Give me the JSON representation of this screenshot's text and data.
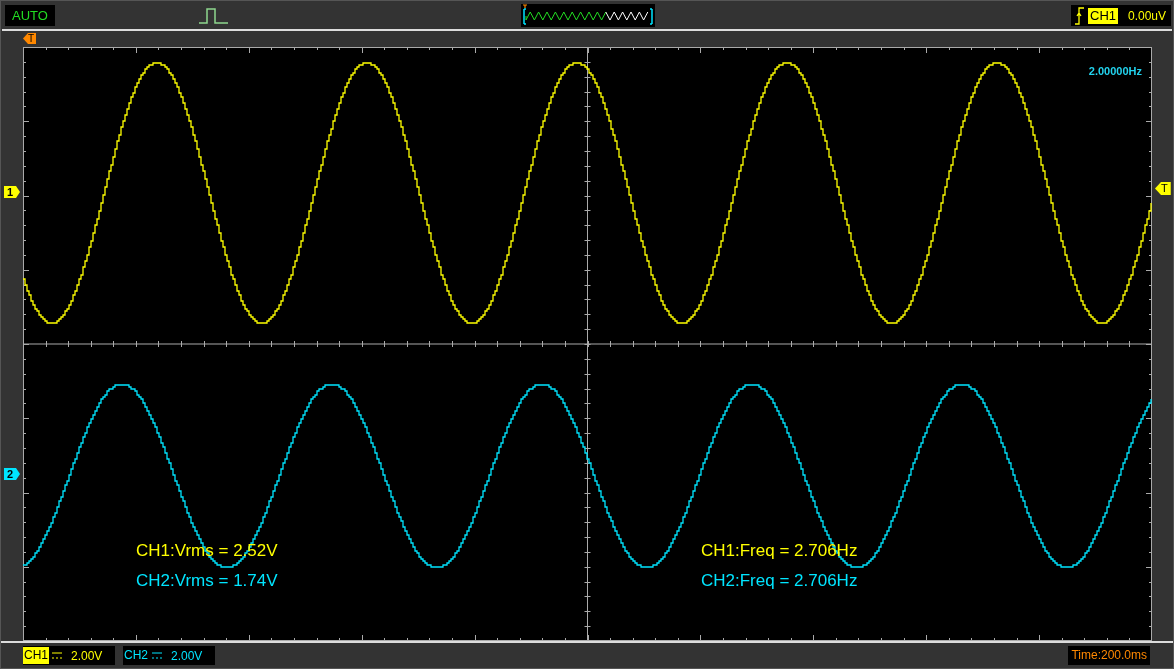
{
  "top_bar": {
    "mode": "AUTO",
    "trigger": {
      "channel": "CH1",
      "level": "0.00uV"
    }
  },
  "trigger_position_marker": "T",
  "trigger_level_marker": "T",
  "channel_markers": [
    {
      "label": "1",
      "color": "#ffff00"
    },
    {
      "label": "2",
      "color": "#00e5ff"
    }
  ],
  "frequency_readout": "2.00000Hz",
  "measurements": [
    {
      "text": "CH1:Vrms = 2.52V",
      "color": "#ffff00"
    },
    {
      "text": "CH1:Freq = 2.706Hz",
      "color": "#ffff00"
    },
    {
      "text": "CH2:Vrms = 1.74V",
      "color": "#00e5ff"
    },
    {
      "text": "CH2:Freq = 2.706Hz",
      "color": "#00e5ff"
    }
  ],
  "bottom_bar": {
    "channels": [
      {
        "name": "CH1",
        "scale": "2.00V",
        "selected": true
      },
      {
        "name": "CH2",
        "scale": "2.00V",
        "selected": false
      }
    ],
    "timebase": "Time:200.0ms"
  }
}
